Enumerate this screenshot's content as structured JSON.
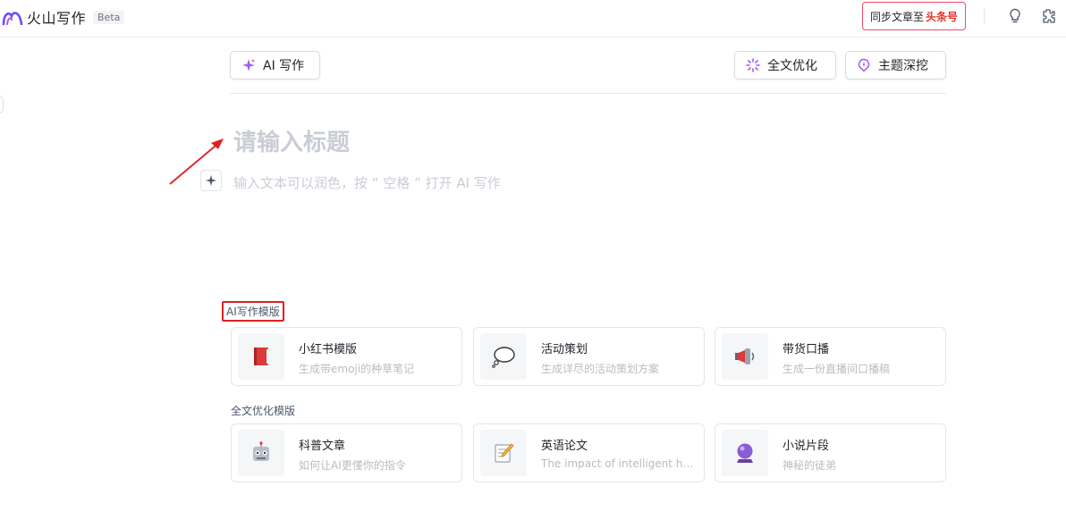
{
  "header": {
    "app_name": "火山写作",
    "badge": "Beta",
    "sync_prefix": "同步文章至",
    "sync_target": "头条号",
    "icons": [
      "lightbulb-icon",
      "plugin-icon"
    ]
  },
  "toolbar": {
    "ai_write": "AI 写作",
    "optimize": "全文优化",
    "topic": "主题深挖"
  },
  "editor": {
    "title_placeholder": "请输入标题",
    "body_placeholder": "输入文本可以润色，按 “ 空格 ” 打开 AI 写作"
  },
  "ai_templates": {
    "label": "AI写作模版",
    "items": [
      {
        "title": "小红书模版",
        "desc": "生成带emoji的种草笔记",
        "icon": "red-book-icon"
      },
      {
        "title": "活动策划",
        "desc": "生成详尽的活动策划方案",
        "icon": "thought-bubble-icon"
      },
      {
        "title": "带货口播",
        "desc": "生成一份直播间口播稿",
        "icon": "megaphone-icon"
      }
    ]
  },
  "optimize_templates": {
    "label": "全文优化模版",
    "items": [
      {
        "title": "科普文章",
        "desc": "如何让AI更懂你的指令",
        "icon": "robot-icon"
      },
      {
        "title": "英语论文",
        "desc": "The impact of intelligent hou···",
        "icon": "memo-icon"
      },
      {
        "title": "小说片段",
        "desc": "神秘的徒弟",
        "icon": "crystal-ball-icon"
      }
    ]
  },
  "colors": {
    "accent_purple": "#7b5cff",
    "brand_red": "#e5332a",
    "annotation_red": "#e02020"
  }
}
